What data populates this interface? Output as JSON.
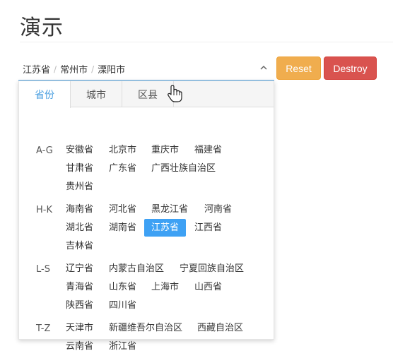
{
  "page": {
    "title": "演示"
  },
  "picker": {
    "province": "江苏省",
    "city": "常州市",
    "district": "溧阳市",
    "separator": "/"
  },
  "buttons": {
    "reset": "Reset",
    "destroy": "Destroy"
  },
  "tabs": [
    "省份",
    "城市",
    "区县"
  ],
  "active_tab": "省份",
  "groups": [
    {
      "label": "A-G",
      "items": [
        "安徽省",
        "北京市",
        "重庆市",
        "福建省",
        "甘肃省",
        "广东省",
        "广西壮族自治区",
        "贵州省"
      ]
    },
    {
      "label": "H-K",
      "items": [
        "海南省",
        "河北省",
        "黑龙江省",
        "河南省",
        "湖北省",
        "湖南省",
        "江苏省",
        "江西省",
        "吉林省"
      ]
    },
    {
      "label": "L-S",
      "items": [
        "辽宁省",
        "内蒙古自治区",
        "宁夏回族自治区",
        "青海省",
        "山东省",
        "上海市",
        "山西省",
        "陕西省",
        "四川省"
      ]
    },
    {
      "label": "T-Z",
      "items": [
        "天津市",
        "新疆维吾尔自治区",
        "西藏自治区",
        "云南省",
        "浙江省"
      ]
    }
  ],
  "selected_province": "江苏省",
  "colors": {
    "accent": "#3ea1f4",
    "reset": "#f0ad4e",
    "destroy": "#d9534f"
  }
}
